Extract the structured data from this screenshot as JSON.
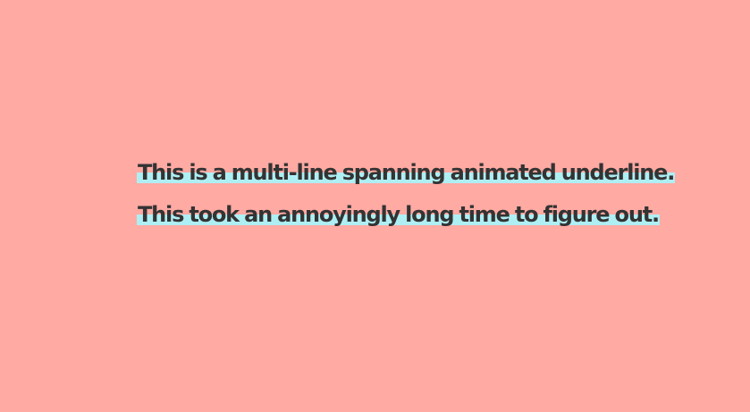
{
  "main": {
    "paragraph_text": "This is a multi-line spanning animated underline. This took an annoyingly long time to figure out.",
    "underline_color": "#aeeff4",
    "text_color": "#333333",
    "background_color": "#ffaaa3"
  }
}
